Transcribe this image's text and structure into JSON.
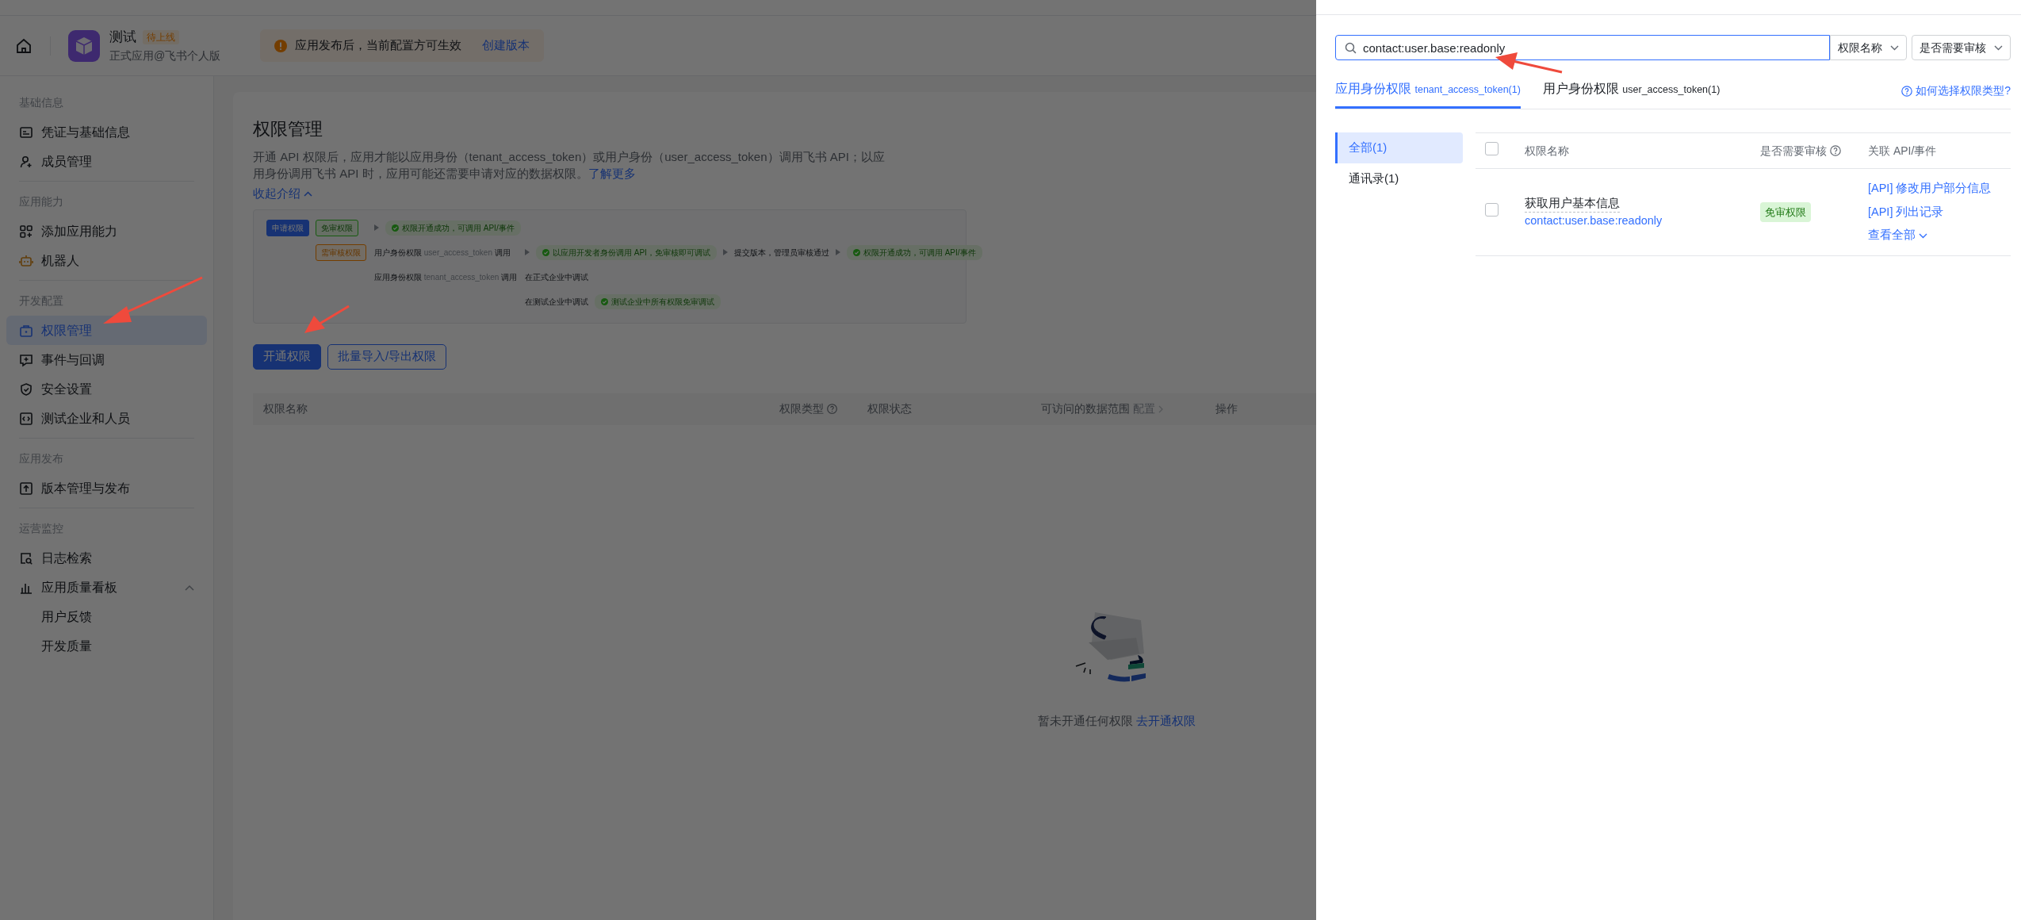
{
  "app_header": {
    "app_name": "测试",
    "status_tag": "待上线",
    "subtitle": "正式应用@飞书个人版",
    "notice": "应用发布后，当前配置方可生效",
    "notice_link": "创建版本"
  },
  "sidebar": {
    "sections": [
      {
        "title": "基础信息",
        "items": [
          {
            "label": "凭证与基础信息",
            "selected": false
          },
          {
            "label": "成员管理",
            "selected": false
          }
        ]
      },
      {
        "title": "应用能力",
        "items": [
          {
            "label": "添加应用能力",
            "selected": false
          },
          {
            "label": "机器人",
            "selected": false
          }
        ]
      },
      {
        "title": "开发配置",
        "items": [
          {
            "label": "权限管理",
            "selected": true
          },
          {
            "label": "事件与回调",
            "selected": false
          },
          {
            "label": "安全设置",
            "selected": false
          },
          {
            "label": "测试企业和人员",
            "selected": false
          }
        ]
      },
      {
        "title": "应用发布",
        "items": [
          {
            "label": "版本管理与发布",
            "selected": false
          }
        ]
      },
      {
        "title": "运营监控",
        "items": [
          {
            "label": "日志检索",
            "selected": false
          },
          {
            "label": "应用质量看板",
            "selected": false,
            "expanded": true,
            "children": [
              {
                "label": "用户反馈",
                "selected": false
              },
              {
                "label": "开发质量",
                "selected": false
              }
            ]
          }
        ]
      }
    ]
  },
  "main": {
    "title": "权限管理",
    "description": "开通 API 权限后，应用才能以应用身份（tenant_access_token）或用户身份（user_access_token）调用飞书 API；以应用身份调用飞书 API 时，应用可能还需要申请对应的数据权限。",
    "description_link": "了解更多",
    "collapse_label": "收起介绍",
    "collapse_expanded": true,
    "diagram": {
      "root": {
        "kind": "start",
        "text": "申请权限",
        "children": [
          {
            "kind": "pass",
            "text": "免审权限",
            "children": [
              {
                "kind": "ok",
                "text": "权限开通成功，可调用 API/事件",
                "arrow_before": true
              }
            ]
          },
          {
            "kind": "review",
            "text": "需审核权限",
            "children": [
              {
                "kind": "identity",
                "text": "用户身份权限",
                "token": "user_access_token",
                "suffix": "调用",
                "children": [
                  {
                    "kind": "ok",
                    "text": "以应用开发者身份调用 API，免审核即可调试",
                    "arrow_before": true,
                    "children": [
                      {
                        "kind": "text",
                        "text": "提交版本，管理员审核通过",
                        "arrow_before": true,
                        "children": [
                          {
                            "kind": "ok",
                            "text": "权限开通成功，可调用 API/事件",
                            "arrow_before": true
                          }
                        ]
                      }
                    ]
                  }
                ]
              },
              {
                "kind": "identity",
                "text": "应用身份权限",
                "token": "tenant_access_token",
                "suffix": "调用",
                "children": [
                  {
                    "kind": "text",
                    "text": "在正式企业中调试",
                    "arrow_before": false
                  },
                  {
                    "kind": "text",
                    "text": "在测试企业中调试",
                    "arrow_before": false,
                    "children": [
                      {
                        "kind": "ok",
                        "text": "测试企业中所有权限免审调试",
                        "arrow_before": false
                      }
                    ]
                  }
                ]
              }
            ]
          }
        ]
      }
    },
    "buttons": [
      {
        "label": "开通权限",
        "kind": "primary"
      },
      {
        "label": "批量导入/导出权限",
        "kind": "outline"
      }
    ],
    "table": {
      "columns": [
        {
          "label": "权限名称",
          "help": false
        },
        {
          "label": "权限类型",
          "help": true
        },
        {
          "label": "权限状态",
          "help": false
        },
        {
          "label": "可访问的数据范围",
          "help": false,
          "action": "配置"
        },
        {
          "label": "操作",
          "help": false
        }
      ]
    },
    "empty_state": {
      "text": "暂未开通任何权限",
      "link": "去开通权限"
    }
  },
  "drawer": {
    "search": {
      "value": "contact:user.base:readonly"
    },
    "filters": [
      {
        "label": "权限名称"
      },
      {
        "label": "是否需要审核"
      }
    ],
    "tabs": [
      {
        "label": "应用身份权限",
        "token": "tenant_access_token(1)",
        "selected": true
      },
      {
        "label": "用户身份权限",
        "token": "user_access_token(1)",
        "selected": false
      }
    ],
    "help_link": "如何选择权限类型?",
    "categories": [
      {
        "label": "全部(1)",
        "selected": true
      },
      {
        "label": "通讯录(1)",
        "selected": false
      }
    ],
    "table": {
      "header_checked": false,
      "columns": [
        {
          "label": "权限名称",
          "help": false
        },
        {
          "label": "是否需要审核",
          "help": true
        },
        {
          "label": "关联 API/事件",
          "help": false
        }
      ],
      "rows": [
        {
          "checked": false,
          "name": "获取用户基本信息",
          "scope": "contact:user.base:readonly",
          "review_tag": "免审权限",
          "apis": [
            "[API] 修改用户部分信息",
            "[API] 列出记录"
          ],
          "more": "查看全部"
        }
      ]
    }
  }
}
